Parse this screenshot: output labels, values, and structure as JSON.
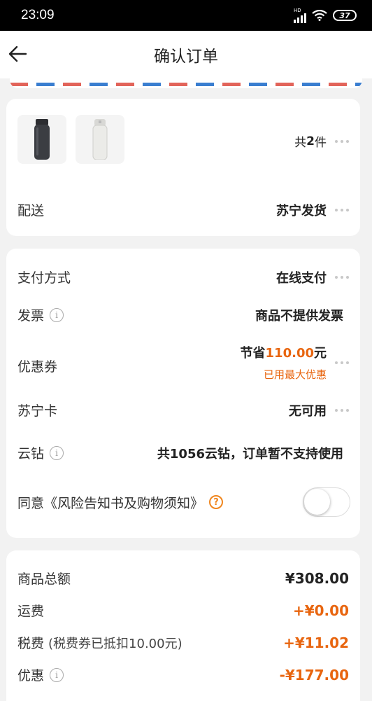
{
  "status_bar": {
    "time": "23:09",
    "network": "HD",
    "battery": "37"
  },
  "header": {
    "title": "确认订单"
  },
  "products": {
    "count_prefix": "共",
    "count": "2",
    "count_suffix": "件",
    "items": [
      {
        "name": "black-thermos-bottle"
      },
      {
        "name": "white-thermos-bottle"
      }
    ]
  },
  "delivery": {
    "label": "配送",
    "value": "苏宁发货"
  },
  "payment": {
    "label": "支付方式",
    "value": "在线支付"
  },
  "invoice": {
    "label": "发票",
    "value": "商品不提供发票"
  },
  "coupon": {
    "label": "优惠券",
    "save_prefix": "节省",
    "save_amount": "110.00",
    "save_suffix": "元",
    "note": "已用最大优惠"
  },
  "suning_card": {
    "label": "苏宁卡",
    "value": "无可用"
  },
  "cloud_diamond": {
    "label": "云钻",
    "value": "共1056云钻，订单暂不支持使用"
  },
  "agreement": {
    "label": "同意《风险告知书及购物须知》",
    "checked": false
  },
  "summary": {
    "subtotal": {
      "label": "商品总额",
      "value": "¥308.00"
    },
    "shipping": {
      "label": "运费",
      "value": "+¥0.00"
    },
    "tax": {
      "label": "税费",
      "note": "(税费券已抵扣10.00元)",
      "value": "+¥11.02"
    },
    "discount": {
      "label": "优惠",
      "value": "-¥177.00"
    }
  },
  "colors": {
    "accent": "#e8650f",
    "help": "#f0861e",
    "stripe_red": "#e2645a",
    "stripe_blue": "#3a7ed0"
  }
}
